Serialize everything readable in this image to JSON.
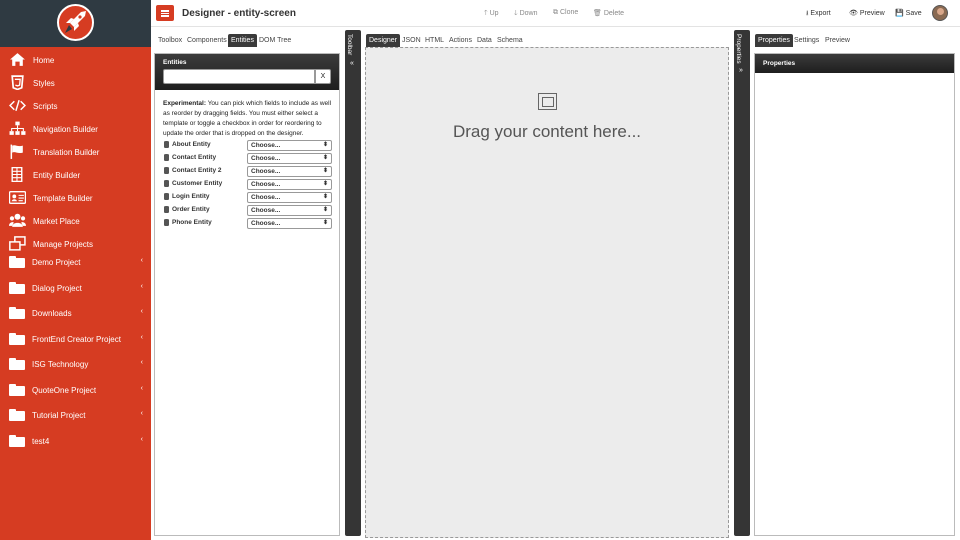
{
  "sidebar": {
    "nav": [
      {
        "label": "Home",
        "icon": "home-icon"
      },
      {
        "label": "Styles",
        "icon": "css3-icon"
      },
      {
        "label": "Scripts",
        "icon": "code-icon"
      },
      {
        "label": "Navigation Builder",
        "icon": "sitemap-icon"
      },
      {
        "label": "Translation Builder",
        "icon": "flag-icon"
      },
      {
        "label": "Entity Builder",
        "icon": "table-icon"
      },
      {
        "label": "Template Builder",
        "icon": "id-card-icon"
      },
      {
        "label": "Market Place",
        "icon": "users-icon"
      },
      {
        "label": "Manage Projects",
        "icon": "projects-icon"
      }
    ],
    "projects": [
      {
        "label": "Demo Project",
        "chevron": "‹"
      },
      {
        "label": "Dialog Project",
        "chevron": "‹"
      },
      {
        "label": "Downloads",
        "chevron": "‹"
      },
      {
        "label": "FrontEnd Creator Project",
        "chevron": "‹"
      },
      {
        "label": "ISG Technology",
        "chevron": "‹"
      },
      {
        "label": "QuoteOne Project",
        "chevron": "‹"
      },
      {
        "label": "Tutorial Project",
        "chevron": "‹"
      },
      {
        "label": "test4",
        "chevron": "‹"
      }
    ]
  },
  "header": {
    "menu_icon": "≡",
    "title": "Designer - entity-screen",
    "up": "Up",
    "down": "Down",
    "clone": "Clone",
    "delete": "Delete",
    "export": "Export",
    "preview": "Preview",
    "save": "Save"
  },
  "left_tabs": [
    "Toolbox",
    "Components",
    "Entities",
    "DOM Tree"
  ],
  "left_tab_active": "Entities",
  "entities_panel": {
    "title": "Entities",
    "search_value": "",
    "clear_label": "X",
    "note_bold": "Experimental:",
    "note_text": " You can pick which fields to include as well as reorder by dragging fields. You must either select a template or toggle a checkbox in order for reordering to update the order that is dropped on the designer.",
    "rows": [
      {
        "name": "About Entity",
        "select": "Choose..."
      },
      {
        "name": "Contact Entity",
        "select": "Choose..."
      },
      {
        "name": "Contact Entity 2",
        "select": "Choose..."
      },
      {
        "name": "Customer Entity",
        "select": "Choose..."
      },
      {
        "name": "Login Entity",
        "select": "Choose..."
      },
      {
        "name": "Order Entity",
        "select": "Choose..."
      },
      {
        "name": "Phone Entity",
        "select": "Choose..."
      }
    ]
  },
  "toolbar_bar": {
    "label": "Toolbar",
    "chevron": "«"
  },
  "center_tabs": [
    "Designer",
    "JSON",
    "HTML",
    "Actions",
    "Data",
    "Schema"
  ],
  "center_tab_active": "Designer",
  "canvas": {
    "drop_text": "Drag your content here..."
  },
  "properties_bar": {
    "label": "Properties",
    "chevron": "»"
  },
  "right_tabs": [
    "Properties",
    "Settings",
    "Preview"
  ],
  "right_tab_active": "Properties",
  "properties_panel": {
    "title": "Properties"
  },
  "colors": {
    "accent": "#d63c22",
    "logo_bg": "#2f3a42",
    "dark_bar": "#353535",
    "canvas_bg": "#ececec"
  }
}
